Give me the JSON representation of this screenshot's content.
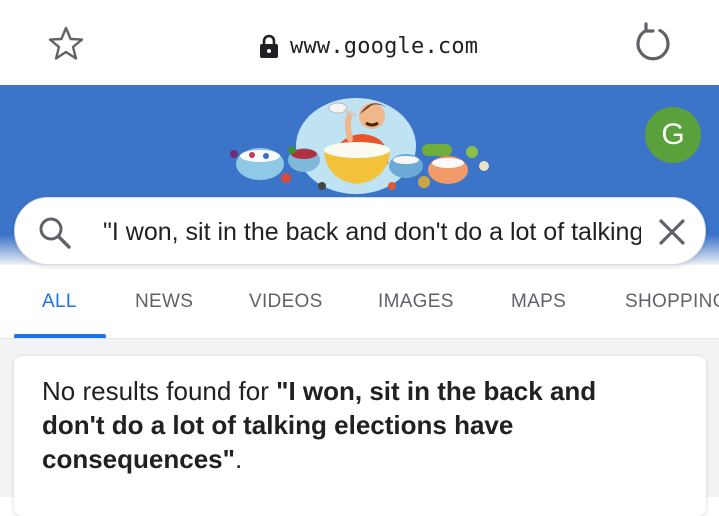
{
  "browser": {
    "url": "www.google.com"
  },
  "account": {
    "avatar_letter": "G",
    "avatar_color": "#5aa13b"
  },
  "search": {
    "query": "\"I won, sit in the back and don't do a lot of talking elections have consequences\""
  },
  "tabs": [
    {
      "label": "ALL",
      "active": true
    },
    {
      "label": "NEWS"
    },
    {
      "label": "VIDEOS"
    },
    {
      "label": "IMAGES"
    },
    {
      "label": "MAPS"
    },
    {
      "label": "SHOPPING"
    }
  ],
  "result": {
    "prefix": "No results found for ",
    "query": "\"I won, sit in the back and don't do a lot of talking elections have consequences\"",
    "suffix": "."
  },
  "colors": {
    "header_blue": "#3b74c8",
    "accent": "#1a73e8"
  },
  "icons": [
    "star-icon",
    "lock-icon",
    "reload-icon",
    "google-doodle",
    "search-icon",
    "clear-icon"
  ]
}
